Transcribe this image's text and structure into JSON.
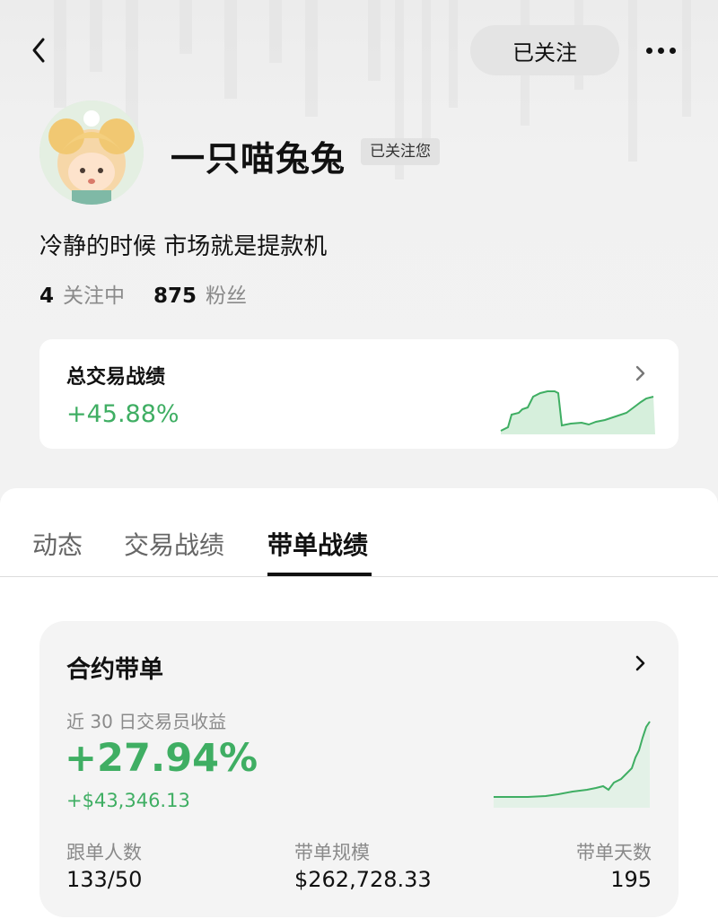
{
  "header": {
    "follow_button": "已关注"
  },
  "profile": {
    "username": "一只喵兔兔",
    "follows_you_badge": "已关注您",
    "bio": "冷静的时候 市场就是提款机",
    "following_count": "4",
    "following_label": "关注中",
    "followers_count": "875",
    "followers_label": "粉丝"
  },
  "overall_performance": {
    "title": "总交易战绩",
    "value": "+45.88%"
  },
  "tabs": [
    {
      "label": "动态",
      "active": false
    },
    {
      "label": "交易战绩",
      "active": false
    },
    {
      "label": "带单战绩",
      "active": true
    }
  ],
  "lead_card": {
    "title": "合约带单",
    "subtitle": "近 30 日交易员收益",
    "return_pct": "+27.94%",
    "return_amount": "+$43,346.13",
    "metrics": [
      {
        "label": "跟单人数",
        "value": "133/50"
      },
      {
        "label": "带单规模",
        "value": "$262,728.33"
      },
      {
        "label": "带单天数",
        "value": "195"
      }
    ]
  },
  "colors": {
    "positive": "#3fae63",
    "chart_fill": "#cdebd5"
  },
  "icons": [
    "back-arrow-icon",
    "more-dots-icon",
    "chevron-right-icon"
  ]
}
